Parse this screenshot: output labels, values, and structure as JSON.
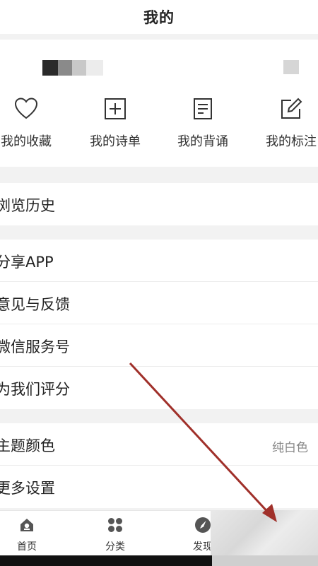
{
  "header": {
    "title": "我的"
  },
  "quick_actions": [
    {
      "label": "我的收藏",
      "icon": "heart-icon"
    },
    {
      "label": "我的诗单",
      "icon": "plus-square-icon"
    },
    {
      "label": "我的背诵",
      "icon": "document-icon"
    },
    {
      "label": "我的标注",
      "icon": "edit-icon"
    }
  ],
  "menu": {
    "history": "浏览历史",
    "share": "分享APP",
    "feedback": "意见与反馈",
    "wechat": "微信服务号",
    "rate": "为我们评分",
    "theme": {
      "label": "主题颜色",
      "value": "纯白色"
    },
    "more_settings": "更多设置"
  },
  "tabbar": [
    {
      "label": "首页",
      "icon": "home-icon"
    },
    {
      "label": "分类",
      "icon": "category-icon"
    },
    {
      "label": "发现",
      "icon": "compass-icon"
    }
  ],
  "colors": {
    "annotation_arrow": "#a0302a",
    "text": "#222222",
    "secondary": "#888888"
  }
}
